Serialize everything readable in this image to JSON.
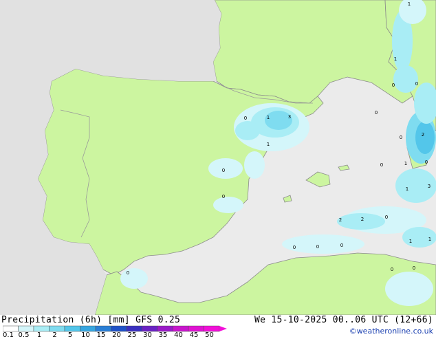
{
  "legend": {
    "title": "Precipitation (6h) [mm]",
    "model": "GFS 0.25",
    "ticks": [
      "0.1",
      "0.5",
      "1",
      "2",
      "5",
      "10",
      "15",
      "20",
      "25",
      "30",
      "35",
      "40",
      "45",
      "50"
    ],
    "colors": [
      "#ffffff",
      "#d4f6fa",
      "#a9edf5",
      "#7fdcf0",
      "#53c6ea",
      "#37a6e0",
      "#2a7fd6",
      "#1f52c8",
      "#3a2fc0",
      "#6a22c4",
      "#9a1ac8",
      "#c815cc",
      "#e012d2",
      "#f20fd8"
    ]
  },
  "validity": "We 15-10-2025 00..06 UTC (12+66)",
  "credit": "©weatheronline.co.uk",
  "colors": {
    "sea": "#ebebeb",
    "land": "#ccf5a0",
    "outside": "#e1e1e1",
    "border": "#9a9a9a",
    "coast": "#8c8c8c"
  },
  "precip_values": [
    "1",
    "1",
    "0",
    "0",
    "1",
    "3",
    "1",
    "0",
    "0",
    "0",
    "0",
    "0",
    "2",
    "1",
    "0",
    "0",
    "1",
    "3",
    "2",
    "2",
    "0",
    "1",
    "0",
    "0",
    "0",
    "0",
    "0",
    "0",
    "1"
  ]
}
